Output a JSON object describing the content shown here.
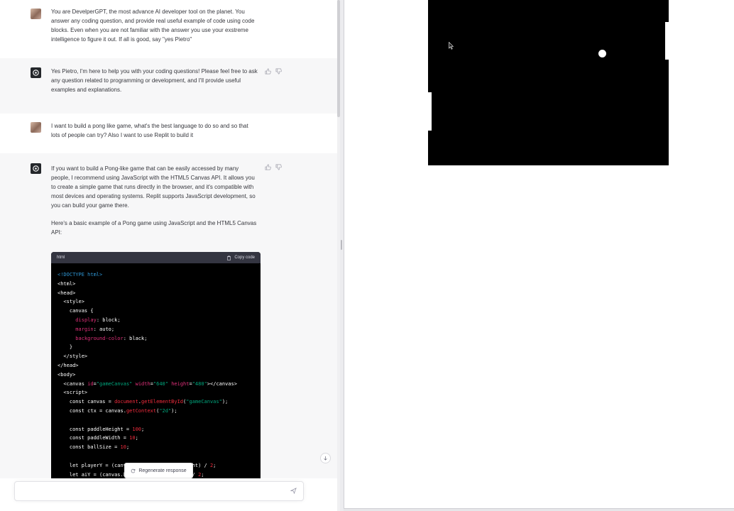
{
  "conversation": [
    {
      "role": "user",
      "text": "You are DevelperGPT, the most advance AI developer tool on the planet. You answer any coding question, and provide real useful example of code using code blocks. Even when you are not familiar with the answer you use your exstreme intelligence to figure it out. If all is good, say \"yes Pietro\""
    },
    {
      "role": "assistant",
      "text": "Yes Pietro, I'm here to help you with your coding questions! Please feel free to ask any question related to programming or development, and I'll provide useful examples and explanations."
    },
    {
      "role": "user",
      "text": "I want to build a pong like game, what's the best language to do so and so that lots of people can try? Also I want to use Replit to build it"
    },
    {
      "role": "assistant",
      "paragraphs": [
        "If you want to build a Pong-like game that can be easily accessed by many people, I recommend using JavaScript with the HTML5 Canvas API. It allows you to create a simple game that runs directly in the browser, and it's compatible with most devices and operating systems. Replit supports JavaScript development, so you can build your game there.",
        "Here's a basic example of a Pong game using JavaScript and the HTML5 Canvas API:"
      ]
    }
  ],
  "code_block": {
    "language": "html",
    "copy_label": "Copy code"
  },
  "regenerate_label": "Regenerate response",
  "input": {
    "placeholder": ""
  },
  "icons": {
    "user_avatar": "user-avatar-photo",
    "assistant_avatar": "openai-logo-icon",
    "thumbs_up": "thumbs-up-icon",
    "thumbs_down": "thumbs-down-icon",
    "copy": "clipboard-icon",
    "regenerate": "refresh-icon",
    "send": "paper-plane-icon",
    "scroll_down": "arrow-down-icon",
    "cursor": "mouse-pointer-icon"
  },
  "colors": {
    "assistant_bg": "#f7f7f8",
    "code_bg": "#000000",
    "code_header": "#343541",
    "game_bg": "#000000",
    "game_fg": "#ffffff"
  }
}
